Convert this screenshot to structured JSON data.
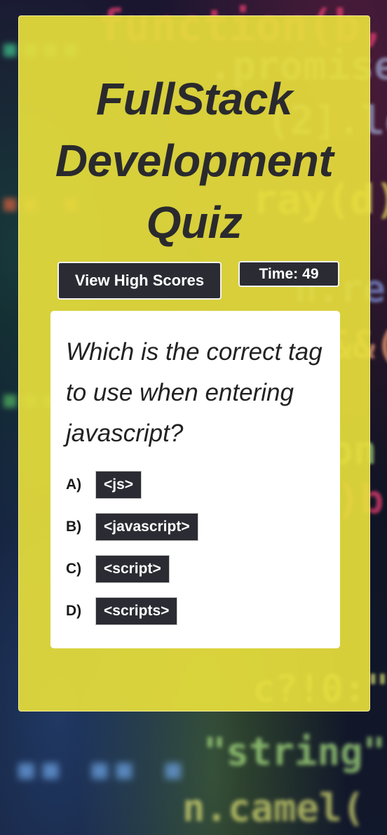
{
  "quiz": {
    "title_lines": [
      "FullStack",
      "Development",
      "Quiz"
    ],
    "high_scores_label": "View High Scores",
    "timer": {
      "label": "Time:",
      "value": "49"
    },
    "question": "Which is the correct tag to use when entering javascript?",
    "answers": [
      {
        "letter": "A)",
        "text": "<js>"
      },
      {
        "letter": "B)",
        "text": "<javascript>"
      },
      {
        "letter": "C)",
        "text": "<script>"
      },
      {
        "letter": "D)",
        "text": "<scripts>"
      }
    ]
  },
  "colors": {
    "panel": "#e6de3c",
    "button": "#2b2c33",
    "card": "#ffffff",
    "title_text": "#2a2a2e"
  }
}
